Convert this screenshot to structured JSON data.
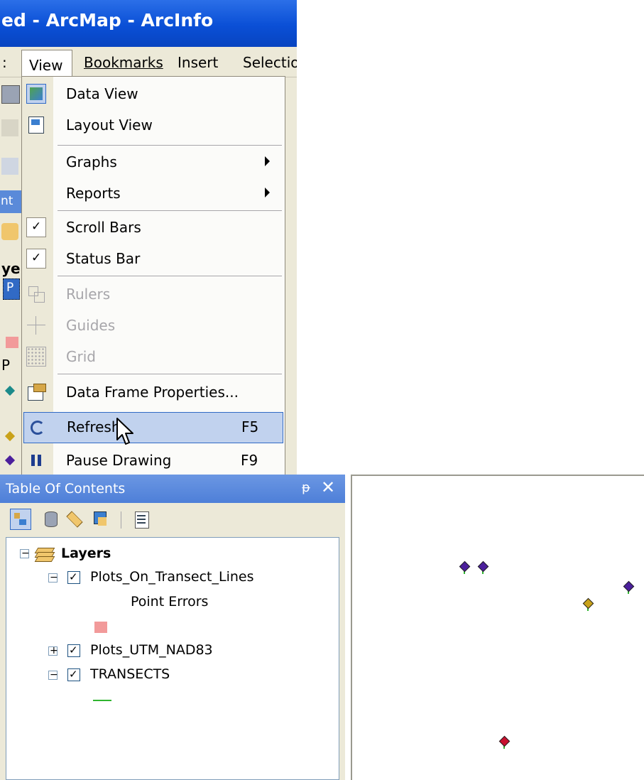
{
  "window": {
    "title": "ed - ArcMap - ArcInfo"
  },
  "menubar": {
    "items": [
      {
        "label": ":"
      },
      {
        "label": "View"
      },
      {
        "label": "Bookmarks"
      },
      {
        "label": "Insert"
      },
      {
        "label": "Selectio"
      }
    ]
  },
  "strip": {
    "label_nt": "nt",
    "label_ye": "ye",
    "label_p1": "P",
    "label_p2": "P"
  },
  "view_menu": {
    "items": [
      {
        "label": "Data View",
        "state": "checked",
        "icon": "data-view-icon"
      },
      {
        "label": "Layout View",
        "icon": "layout-view-icon"
      },
      {
        "label": "Graphs",
        "submenu": true
      },
      {
        "label": "Reports",
        "submenu": true
      },
      {
        "label": "Scroll Bars",
        "state": "checked",
        "icon": "check-icon"
      },
      {
        "label": "Status Bar",
        "state": "checked",
        "icon": "check-icon"
      },
      {
        "label": "Rulers",
        "disabled": true,
        "icon": "rulers-icon"
      },
      {
        "label": "Guides",
        "disabled": true,
        "icon": "guides-icon"
      },
      {
        "label": "Grid",
        "disabled": true,
        "icon": "grid-icon"
      },
      {
        "label": "Data Frame Properties...",
        "icon": "data-frame-properties-icon"
      },
      {
        "label": "Refresh",
        "shortcut": "F5",
        "highlighted": true,
        "icon": "refresh-icon"
      },
      {
        "label": "Pause Drawing",
        "shortcut": "F9",
        "icon": "pause-icon"
      }
    ]
  },
  "toc": {
    "title": "Table Of Contents",
    "pin": "ᵽ",
    "close": "✕",
    "root": {
      "label": "Layers"
    },
    "layers": [
      {
        "label": "Plots_On_Transect_Lines",
        "checked": true,
        "expanded": true,
        "sub_label": "Point Errors",
        "symbol_color": "#f29a9a"
      },
      {
        "label": "Plots_UTM_NAD83",
        "checked": true,
        "expanded": false
      },
      {
        "label": "TRANSECTS",
        "checked": true,
        "expanded": true,
        "symbol_color": "#2fb52f"
      }
    ]
  },
  "map": {
    "points": [
      {
        "color": "#4b1f9c"
      },
      {
        "color": "#4b1f9c"
      },
      {
        "color": "#c9a21a"
      },
      {
        "color": "#4b1f9c"
      },
      {
        "color": "#c8102e"
      }
    ]
  },
  "colors": {
    "titlebar": "#0a4fd6",
    "menu_highlight": "#c1d2ee",
    "toc_title": "#5a8ad9"
  }
}
